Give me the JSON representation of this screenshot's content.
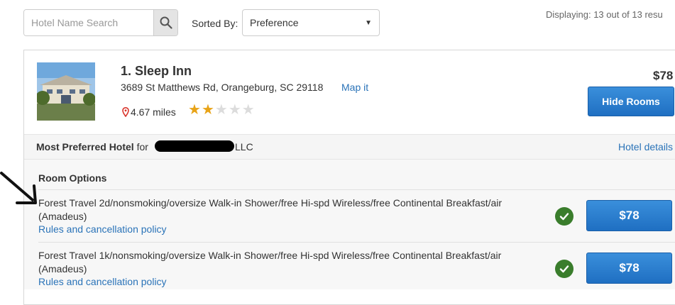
{
  "search": {
    "placeholder": "Hotel Name Search",
    "value": ""
  },
  "sort": {
    "label": "Sorted By:",
    "selected": "Preference"
  },
  "displaying": "Displaying: 13 out of 13 resu",
  "hotel": {
    "name": "1. Sleep Inn",
    "address": "3689 St Matthews Rd, Orangeburg, SC 29118",
    "map_link": "Map it",
    "distance": "4.67 miles",
    "rating": 2,
    "rating_max": 5,
    "price": "$78",
    "hide_rooms_label": "Hide Rooms",
    "preferred_label": "Most Preferred Hotel",
    "preferred_for": "for",
    "preferred_suffix": "LLC",
    "details_link": "Hotel details"
  },
  "rooms": {
    "title": "Room Options",
    "items": [
      {
        "description": "Forest Travel 2d/nonsmoking/oversize Walk-in Shower/free Hi-spd Wireless/free Continental Breakfast/air (Amadeus)",
        "policy_link": "Rules and cancellation policy",
        "price": "$78"
      },
      {
        "description": "Forest Travel 1k/nonsmoking/oversize Walk-in Shower/free Hi-spd Wireless/free Continental Breakfast/air (Amadeus)",
        "policy_link": "Rules and cancellation policy",
        "price": "$78"
      }
    ]
  },
  "colors": {
    "link": "#2a73b8",
    "button": "#1f6fc2",
    "check": "#3a7d2c",
    "star": "#e8a317"
  },
  "icons": {
    "search": "magnifier-icon",
    "location": "map-pin-icon",
    "check": "checkmark-icon",
    "dropdown": "caret-down-icon"
  }
}
